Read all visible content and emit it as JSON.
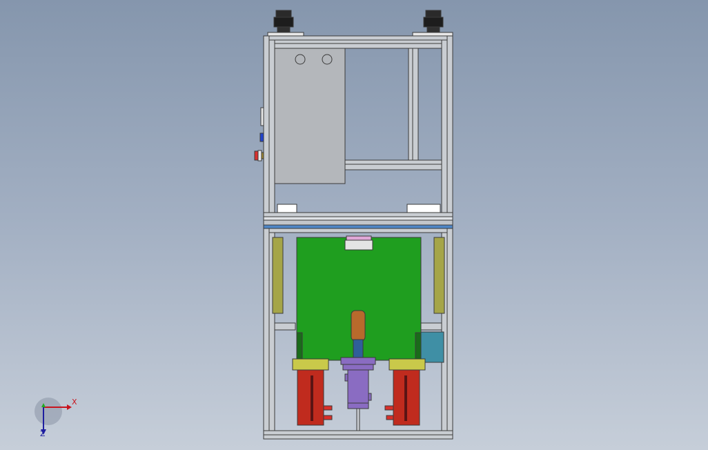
{
  "viewport": {
    "background_top": "#8596ad",
    "background_bottom": "#c6ced9"
  },
  "colors": {
    "frame": "#c9cdd2",
    "frame_edge": "#3a3a3a",
    "panel": "#b4b7bb",
    "green_block": "#1f9e1f",
    "yellow_plate": "#c9c94a",
    "olive_side": "#a5a548",
    "red_cylinder": "#c02b1e",
    "purple_cylinder": "#8a6cc2",
    "cyan_box": "#3f8fa5",
    "blue_strip": "#4f86c6",
    "copper_rod": "#b86a2c"
  },
  "triad": {
    "x_label": "X",
    "z_label": "Z",
    "x_color": "#c8141e",
    "y_color": "#22aa22",
    "z_color": "#1e1ea0"
  }
}
